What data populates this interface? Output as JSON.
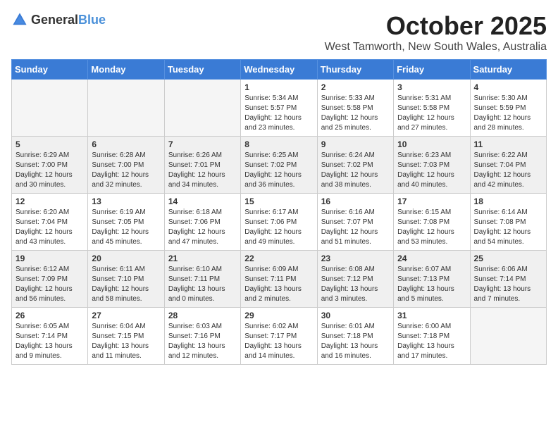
{
  "logo": {
    "general": "General",
    "blue": "Blue"
  },
  "header": {
    "month": "October 2025",
    "location": "West Tamworth, New South Wales, Australia"
  },
  "weekdays": [
    "Sunday",
    "Monday",
    "Tuesday",
    "Wednesday",
    "Thursday",
    "Friday",
    "Saturday"
  ],
  "weeks": [
    [
      {
        "day": "",
        "info": ""
      },
      {
        "day": "",
        "info": ""
      },
      {
        "day": "",
        "info": ""
      },
      {
        "day": "1",
        "info": "Sunrise: 5:34 AM\nSunset: 5:57 PM\nDaylight: 12 hours\nand 23 minutes."
      },
      {
        "day": "2",
        "info": "Sunrise: 5:33 AM\nSunset: 5:58 PM\nDaylight: 12 hours\nand 25 minutes."
      },
      {
        "day": "3",
        "info": "Sunrise: 5:31 AM\nSunset: 5:58 PM\nDaylight: 12 hours\nand 27 minutes."
      },
      {
        "day": "4",
        "info": "Sunrise: 5:30 AM\nSunset: 5:59 PM\nDaylight: 12 hours\nand 28 minutes."
      }
    ],
    [
      {
        "day": "5",
        "info": "Sunrise: 6:29 AM\nSunset: 7:00 PM\nDaylight: 12 hours\nand 30 minutes."
      },
      {
        "day": "6",
        "info": "Sunrise: 6:28 AM\nSunset: 7:00 PM\nDaylight: 12 hours\nand 32 minutes."
      },
      {
        "day": "7",
        "info": "Sunrise: 6:26 AM\nSunset: 7:01 PM\nDaylight: 12 hours\nand 34 minutes."
      },
      {
        "day": "8",
        "info": "Sunrise: 6:25 AM\nSunset: 7:02 PM\nDaylight: 12 hours\nand 36 minutes."
      },
      {
        "day": "9",
        "info": "Sunrise: 6:24 AM\nSunset: 7:02 PM\nDaylight: 12 hours\nand 38 minutes."
      },
      {
        "day": "10",
        "info": "Sunrise: 6:23 AM\nSunset: 7:03 PM\nDaylight: 12 hours\nand 40 minutes."
      },
      {
        "day": "11",
        "info": "Sunrise: 6:22 AM\nSunset: 7:04 PM\nDaylight: 12 hours\nand 42 minutes."
      }
    ],
    [
      {
        "day": "12",
        "info": "Sunrise: 6:20 AM\nSunset: 7:04 PM\nDaylight: 12 hours\nand 43 minutes."
      },
      {
        "day": "13",
        "info": "Sunrise: 6:19 AM\nSunset: 7:05 PM\nDaylight: 12 hours\nand 45 minutes."
      },
      {
        "day": "14",
        "info": "Sunrise: 6:18 AM\nSunset: 7:06 PM\nDaylight: 12 hours\nand 47 minutes."
      },
      {
        "day": "15",
        "info": "Sunrise: 6:17 AM\nSunset: 7:06 PM\nDaylight: 12 hours\nand 49 minutes."
      },
      {
        "day": "16",
        "info": "Sunrise: 6:16 AM\nSunset: 7:07 PM\nDaylight: 12 hours\nand 51 minutes."
      },
      {
        "day": "17",
        "info": "Sunrise: 6:15 AM\nSunset: 7:08 PM\nDaylight: 12 hours\nand 53 minutes."
      },
      {
        "day": "18",
        "info": "Sunrise: 6:14 AM\nSunset: 7:08 PM\nDaylight: 12 hours\nand 54 minutes."
      }
    ],
    [
      {
        "day": "19",
        "info": "Sunrise: 6:12 AM\nSunset: 7:09 PM\nDaylight: 12 hours\nand 56 minutes."
      },
      {
        "day": "20",
        "info": "Sunrise: 6:11 AM\nSunset: 7:10 PM\nDaylight: 12 hours\nand 58 minutes."
      },
      {
        "day": "21",
        "info": "Sunrise: 6:10 AM\nSunset: 7:11 PM\nDaylight: 13 hours\nand 0 minutes."
      },
      {
        "day": "22",
        "info": "Sunrise: 6:09 AM\nSunset: 7:11 PM\nDaylight: 13 hours\nand 2 minutes."
      },
      {
        "day": "23",
        "info": "Sunrise: 6:08 AM\nSunset: 7:12 PM\nDaylight: 13 hours\nand 3 minutes."
      },
      {
        "day": "24",
        "info": "Sunrise: 6:07 AM\nSunset: 7:13 PM\nDaylight: 13 hours\nand 5 minutes."
      },
      {
        "day": "25",
        "info": "Sunrise: 6:06 AM\nSunset: 7:14 PM\nDaylight: 13 hours\nand 7 minutes."
      }
    ],
    [
      {
        "day": "26",
        "info": "Sunrise: 6:05 AM\nSunset: 7:14 PM\nDaylight: 13 hours\nand 9 minutes."
      },
      {
        "day": "27",
        "info": "Sunrise: 6:04 AM\nSunset: 7:15 PM\nDaylight: 13 hours\nand 11 minutes."
      },
      {
        "day": "28",
        "info": "Sunrise: 6:03 AM\nSunset: 7:16 PM\nDaylight: 13 hours\nand 12 minutes."
      },
      {
        "day": "29",
        "info": "Sunrise: 6:02 AM\nSunset: 7:17 PM\nDaylight: 13 hours\nand 14 minutes."
      },
      {
        "day": "30",
        "info": "Sunrise: 6:01 AM\nSunset: 7:18 PM\nDaylight: 13 hours\nand 16 minutes."
      },
      {
        "day": "31",
        "info": "Sunrise: 6:00 AM\nSunset: 7:18 PM\nDaylight: 13 hours\nand 17 minutes."
      },
      {
        "day": "",
        "info": ""
      }
    ]
  ]
}
